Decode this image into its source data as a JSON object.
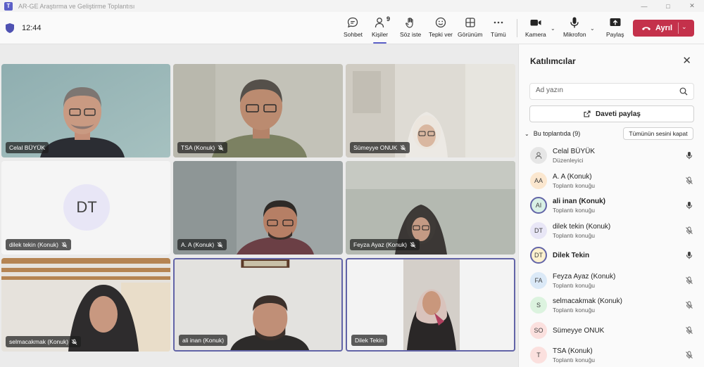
{
  "window": {
    "title": "AR-GE Araştırma ve Geliştirme Toplantısı",
    "app_icon": "teams-icon"
  },
  "toolbar": {
    "clock": "12:44",
    "buttons": {
      "chat": "Sohbet",
      "people": "Kişiler",
      "people_count": "9",
      "raise": "Söz iste",
      "react": "Tepki ver",
      "view": "Görünüm",
      "more": "Tümü",
      "camera": "Kamera",
      "mic": "Mikrofon",
      "share": "Paylaş"
    },
    "leave": "Ayrıl",
    "leave_color": "#c4314b"
  },
  "tiles": [
    {
      "name": "Celal BÜYÜK",
      "muted": false
    },
    {
      "name": "TSA (Konuk)",
      "muted": true
    },
    {
      "name": "Sümeyye ONUK",
      "muted": true
    },
    {
      "name": "dilek tekin (Konuk)",
      "muted": true,
      "initials": "DT"
    },
    {
      "name": "A. A (Konuk)",
      "muted": true
    },
    {
      "name": "Feyza Ayaz (Konuk)",
      "muted": true
    },
    {
      "name": "selmacakmak (Konuk)",
      "muted": true
    },
    {
      "name": "ali inan (Konuk)",
      "muted": false
    },
    {
      "name": "Dilek Tekin",
      "muted": false
    }
  ],
  "panel": {
    "title": "Katılımcılar",
    "search_placeholder": "Ad yazın",
    "share_invite": "Daveti paylaş",
    "section": "Bu toplantıda (9)",
    "mute_all": "Tümünün sesini kapat",
    "accent": "#6264a7",
    "participants": [
      {
        "initials": "",
        "name": "Celal BÜYÜK",
        "role": "Düzenleyici",
        "bold": false,
        "muted": false,
        "ring": false,
        "bg": "#e6e6e6"
      },
      {
        "initials": "AA",
        "name": "A. A (Konuk)",
        "role": "Toplantı konuğu",
        "bold": false,
        "muted": true,
        "ring": false,
        "bg": "#fbe7cf"
      },
      {
        "initials": "AI",
        "name": "ali inan (Konuk)",
        "role": "Toplantı konuğu",
        "bold": true,
        "muted": false,
        "ring": true,
        "bg": "#d9f1e6"
      },
      {
        "initials": "DT",
        "name": "dilek tekin (Konuk)",
        "role": "Toplantı konuğu",
        "bold": false,
        "muted": true,
        "ring": false,
        "bg": "#e8e6f6"
      },
      {
        "initials": "DT",
        "name": "Dilek Tekin",
        "role": "",
        "bold": true,
        "muted": false,
        "ring": true,
        "bg": "#fdf1cf"
      },
      {
        "initials": "FA",
        "name": "Feyza Ayaz (Konuk)",
        "role": "Toplantı konuğu",
        "bold": false,
        "muted": true,
        "ring": false,
        "bg": "#dbe9f7"
      },
      {
        "initials": "S",
        "name": "selmacakmak (Konuk)",
        "role": "Toplantı konuğu",
        "bold": false,
        "muted": true,
        "ring": false,
        "bg": "#dcf3df"
      },
      {
        "initials": "SO",
        "name": "Sümeyye ONUK",
        "role": "",
        "bold": false,
        "muted": true,
        "ring": false,
        "bg": "#fbe0de"
      },
      {
        "initials": "T",
        "name": "TSA (Konuk)",
        "role": "Toplantı konuğu",
        "bold": false,
        "muted": true,
        "ring": false,
        "bg": "#fbe0de"
      }
    ]
  }
}
